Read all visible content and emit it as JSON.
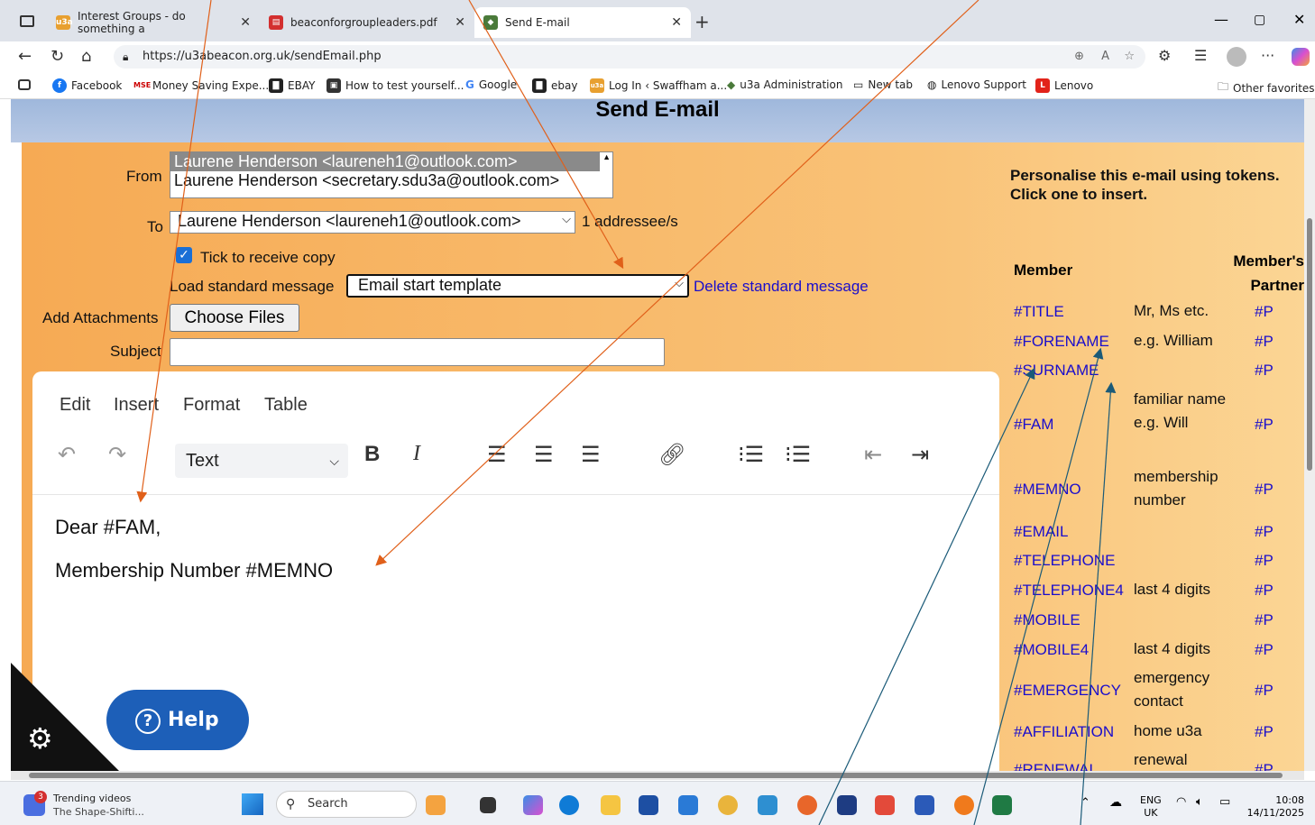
{
  "browser": {
    "tabs": [
      {
        "label": "Interest Groups - do something a",
        "active": false
      },
      {
        "label": "beaconforgroupleaders.pdf",
        "active": false
      },
      {
        "label": "Send E-mail",
        "active": true
      }
    ],
    "url": "https://u3abeacon.org.uk/sendEmail.php",
    "favorites": [
      "Facebook",
      "Money Saving Expe...",
      "EBAY",
      "How to test yourself...",
      "Google",
      "ebay",
      "Log In ‹ Swaffham a...",
      "u3a Administration",
      "New tab",
      "Lenovo Support",
      "Lenovo"
    ],
    "other_favorites": "Other favorites"
  },
  "page": {
    "title": "Send E-mail",
    "from_label": "From",
    "from_options": [
      "Laurene Henderson <laureneh1@outlook.com>",
      "Laurene Henderson <secretary.sdu3a@outlook.com>"
    ],
    "to_label": "To",
    "to_value": "Laurene Henderson <laureneh1@outlook.com>",
    "addressee_count": "1 addressee/s",
    "copy_label": "Tick to receive copy",
    "load_label": "Load standard message",
    "load_value": "Email start template",
    "delete_link": "Delete standard message",
    "attach_label": "Add Attachments",
    "choose_files": "Choose Files",
    "subject_label": "Subject",
    "subject_value": ""
  },
  "editor": {
    "menu": [
      "Edit",
      "Insert",
      "Format",
      "Table"
    ],
    "block_format": "Text",
    "line1": "Dear #FAM,",
    "line2": "Membership Number #MEMNO",
    "help": "Help"
  },
  "tokens": {
    "heading": "Personalise this e-mail using tokens.",
    "subheading": "Click one to insert.",
    "member_header": "Member",
    "partner_header": "Member's Partner",
    "rows": [
      {
        "token": "#TITLE",
        "desc": "Mr, Ms etc.",
        "p": "#P"
      },
      {
        "token": "#FORENAME",
        "desc": "e.g. William",
        "p": "#P"
      },
      {
        "token": "#SURNAME",
        "desc": "",
        "p": "#P"
      },
      {
        "token": "#FAM",
        "desc": "familiar name e.g. Will",
        "p": "#P"
      },
      {
        "token": "#MEMNO",
        "desc": "membership number",
        "p": "#P"
      },
      {
        "token": "#EMAIL",
        "desc": "",
        "p": "#P"
      },
      {
        "token": "#TELEPHONE",
        "desc": "",
        "p": "#P"
      },
      {
        "token": "#TELEPHONE4",
        "desc": "last 4 digits",
        "p": "#P"
      },
      {
        "token": "#MOBILE",
        "desc": "",
        "p": "#P"
      },
      {
        "token": "#MOBILE4",
        "desc": "last 4 digits",
        "p": "#P"
      },
      {
        "token": "#EMERGENCY",
        "desc": "emergency contact",
        "p": "#P"
      },
      {
        "token": "#AFFILIATION",
        "desc": "home u3a",
        "p": "#P"
      },
      {
        "token": "#RENEWAL",
        "desc": "renewal",
        "p": "#P"
      }
    ]
  },
  "taskbar": {
    "widget_title": "Trending videos",
    "widget_sub": "The Shape-Shifti...",
    "widget_badge": "3",
    "search": "Search",
    "lang": "ENG",
    "region": "UK",
    "time": "10:08",
    "date": "14/11/2025"
  }
}
